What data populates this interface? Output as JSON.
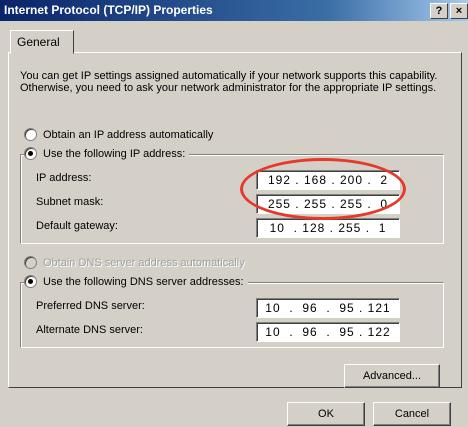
{
  "window": {
    "title": "Internet Protocol (TCP/IP) Properties",
    "help_button": "?",
    "close_button": "×"
  },
  "tabs": [
    {
      "label": "General"
    }
  ],
  "intro_text": "You can get IP settings assigned automatically if your network supports this capability. Otherwise, you need to ask your network administrator for the appropriate IP settings.",
  "ip_options": {
    "auto_label": "Obtain an IP address automatically",
    "manual_label": "Use the following IP address:",
    "selected": "manual"
  },
  "ip_fields": [
    {
      "label": "IP address:",
      "value": "192 . 168 . 200 .  2"
    },
    {
      "label": "Subnet mask:",
      "value": "255 . 255 . 255 .  0"
    },
    {
      "label": "Default gateway:",
      "value": "10  . 128 . 255 .  1"
    }
  ],
  "dns_options": {
    "auto_label": "Obtain DNS server address automatically",
    "manual_label": "Use the following DNS server addresses:",
    "selected": "manual"
  },
  "dns_fields": [
    {
      "label": "Preferred DNS server:",
      "value": "10  .  96  .  95 . 121"
    },
    {
      "label": "Alternate DNS server:",
      "value": "10  .  96  .  95 . 122"
    }
  ],
  "buttons": {
    "advanced": "Advanced...",
    "ok": "OK",
    "cancel": "Cancel"
  },
  "annotation_color": "#e53a2a"
}
